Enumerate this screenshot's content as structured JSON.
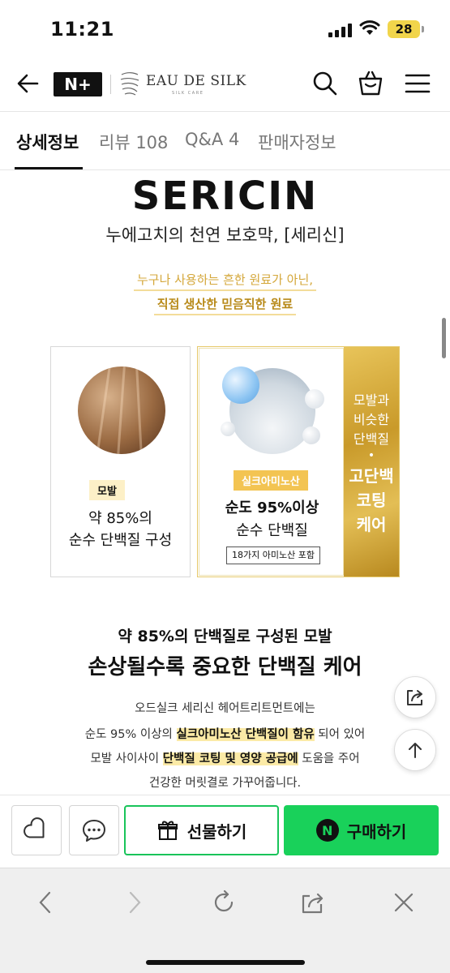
{
  "status_bar": {
    "time": "11:21",
    "battery": "28"
  },
  "header": {
    "nplus_label": "N+",
    "brand_name": "EAU DE SILK",
    "brand_sub": "SILK CARE"
  },
  "tabs": [
    {
      "label": "상세정보",
      "active": true
    },
    {
      "label": "리뷰 108",
      "active": false
    },
    {
      "label": "Q&A 4",
      "active": false
    },
    {
      "label": "판매자정보",
      "active": false
    }
  ],
  "content": {
    "title": "SERICIN",
    "subtitle": "누에고치의 천연 보호막, [세리신]",
    "gold_line1": "누구나 사용하는 흔한 원료가 아닌,",
    "gold_line2": "직접 생산한 믿음직한 원료",
    "card_left": {
      "tag": "모발",
      "line1": "약 85%의",
      "line2": "순수 단백질 구성"
    },
    "card_right": {
      "tag": "실크아미노산",
      "line1": "순도 95%이상",
      "line2": "순수 단백질",
      "box": "18가지 아미노산 포함",
      "panel_line1": "모발과",
      "panel_line2": "비슷한",
      "panel_line3": "단백질",
      "panel_dot": "•",
      "panel_bold1": "고단백",
      "panel_bold2": "코팅",
      "panel_bold3": "케어"
    },
    "heading_small": "약 85%의 단백질로 구성된 모발",
    "heading_big": "손상될수록 중요한 단백질 케어",
    "para1": "오드실크 세리신 헤어트리트먼트에는",
    "para2_pre": "순도 95% 이상의 ",
    "para2_hl": "실크아미노산 단백질이 함유",
    "para2_post": " 되어 있어",
    "para3_pre": "모발 사이사이 ",
    "para3_hl": "단백질 코팅 및 영양 공급에",
    "para3_post": " 도움을 주어",
    "para4": "건강한 머릿결로 가꾸어줍니다."
  },
  "actions": {
    "gift_label": "선물하기",
    "buy_label": "구매하기",
    "buy_badge": "N"
  },
  "colors": {
    "accent_green": "#19d15a",
    "gold": "#d4a73a",
    "highlight": "#fbeaa6"
  }
}
